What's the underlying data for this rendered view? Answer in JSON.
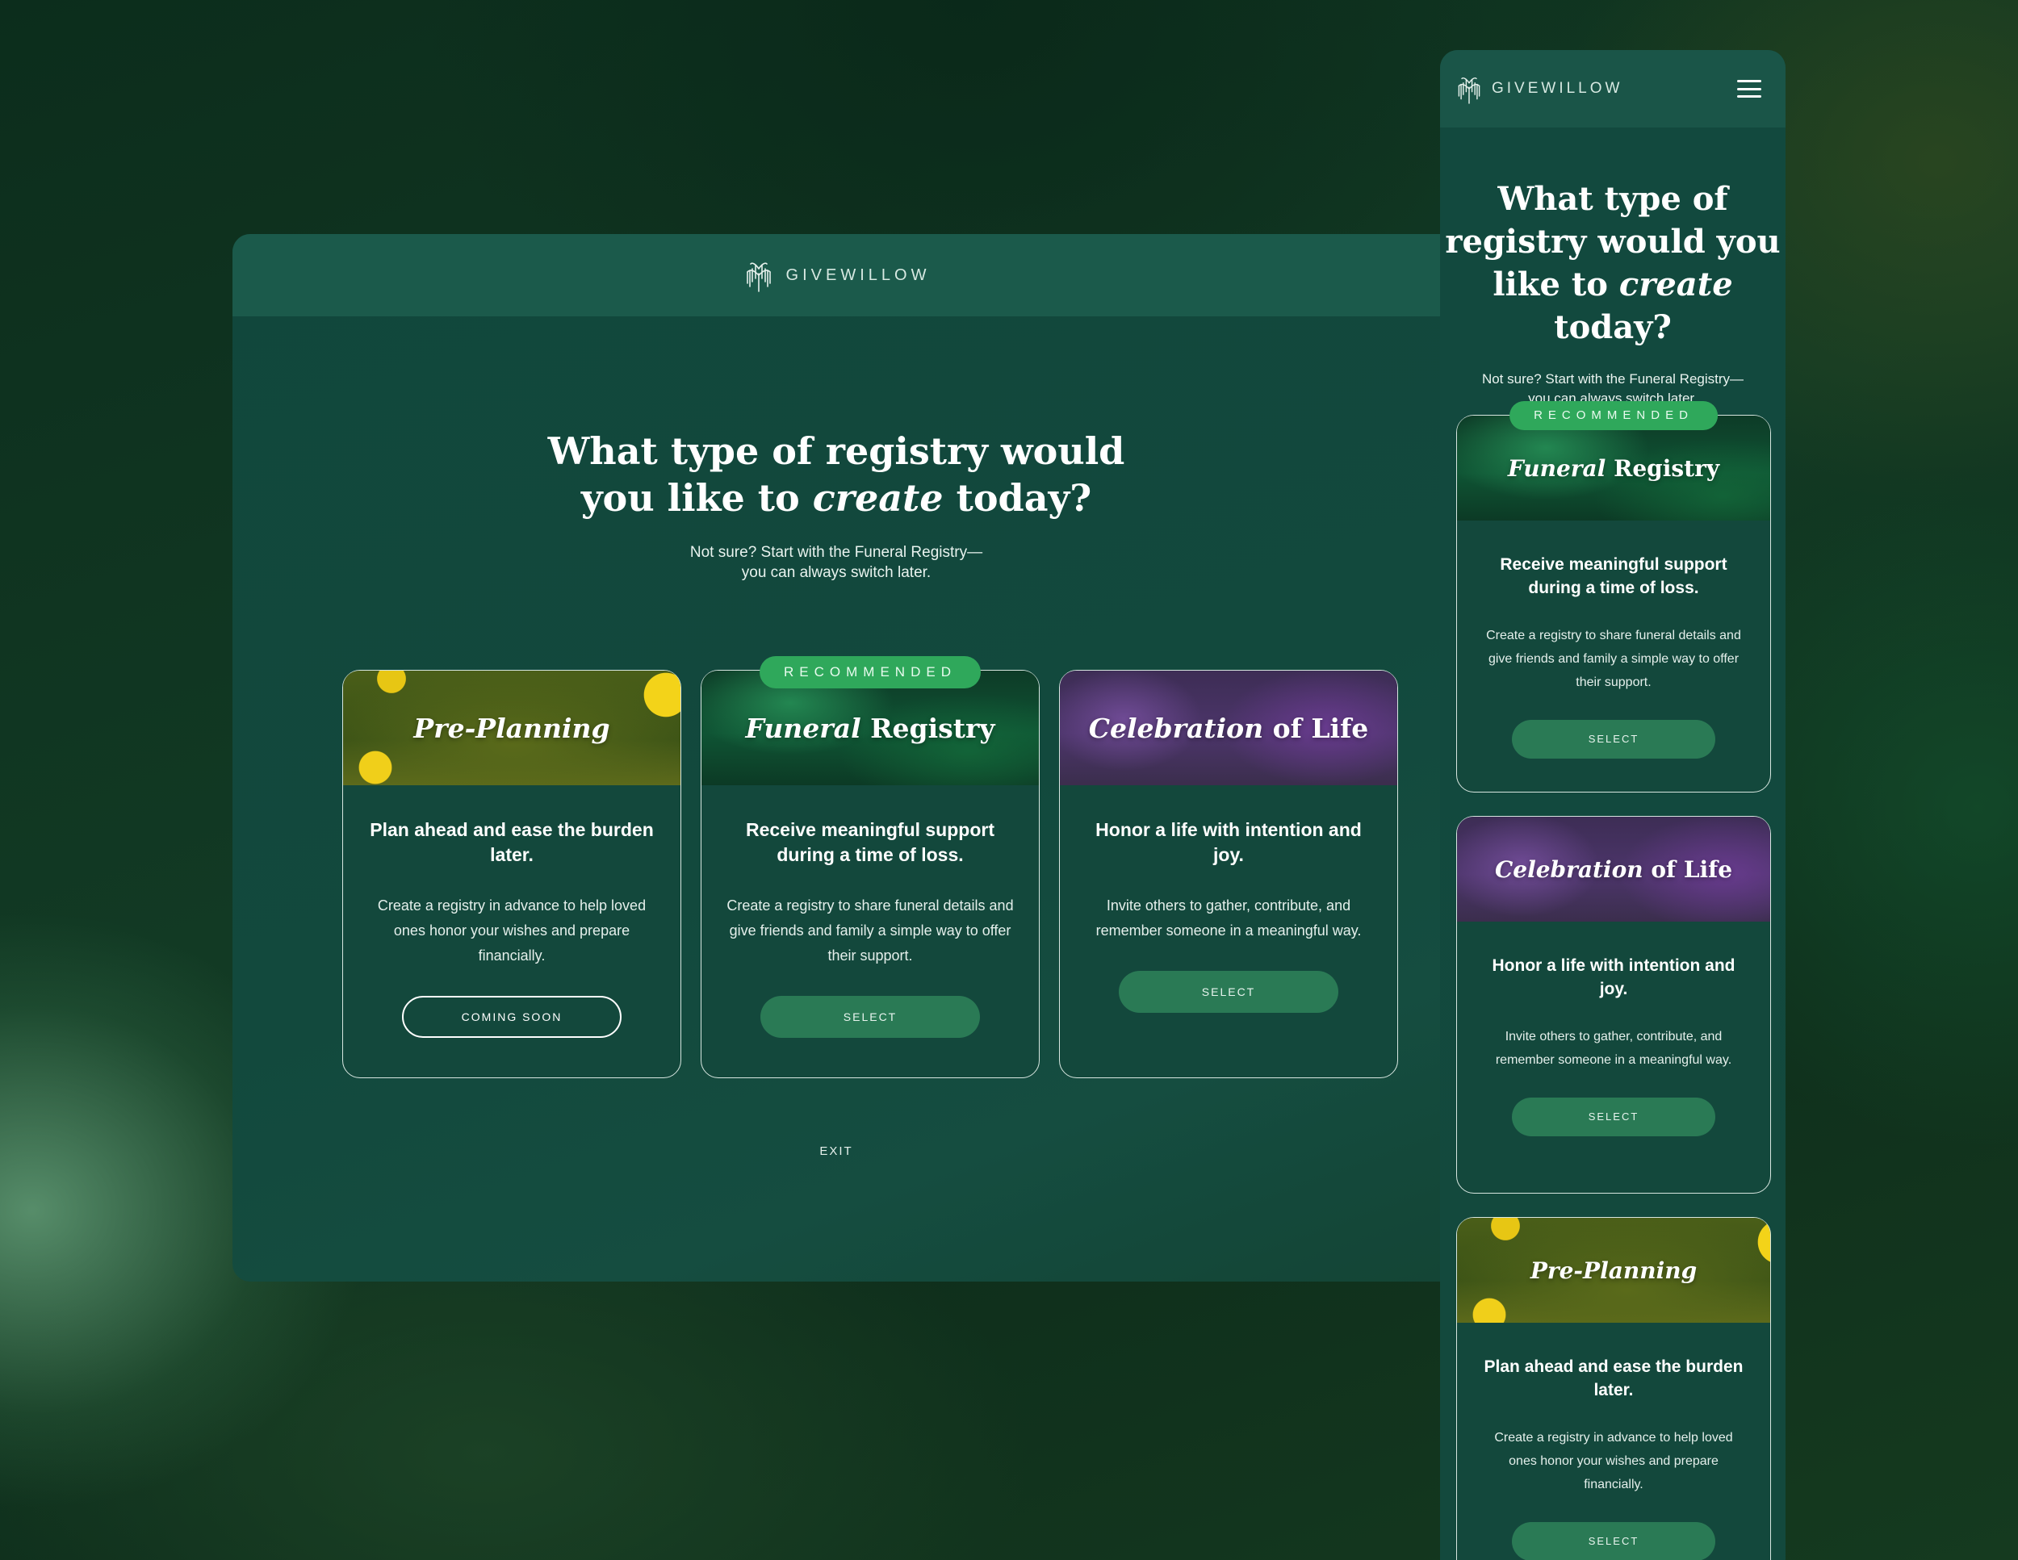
{
  "brand": {
    "name": "GIVEWILLOW"
  },
  "hero": {
    "title_part1": "What type of registry would you like to",
    "title_italic": "create",
    "title_part2": "today?",
    "subtitle_line1": "Not sure? Start with the Funeral Registry—",
    "subtitle_line2": "you can always switch later."
  },
  "badge": {
    "recommended": "RECOMMENDED"
  },
  "cards": {
    "preplanning": {
      "name_italic": "Pre-Planning",
      "heading": "Plan ahead and ease the burden later.",
      "description": "Create a registry in advance to help loved ones honor your wishes and prepare financially.",
      "desktop_button": "COMING SOON",
      "mobile_button": "SELECT"
    },
    "funeral": {
      "name_italic": "Funeral",
      "name_rest": "Registry",
      "heading": "Receive meaningful support during a time of loss.",
      "description": "Create a registry to share funeral details and give friends and family a simple way to offer their support.",
      "button": "SELECT"
    },
    "celebration": {
      "name_italic": "Celebration",
      "name_rest": "of Life",
      "heading": "Honor a life with intention and joy.",
      "description": "Invite others to gather, contribute, and remember someone in a meaningful way.",
      "button": "SELECT"
    }
  },
  "footer": {
    "exit": "EXIT"
  },
  "icons": {
    "logo": "willow-tree-icon",
    "menu": "hamburger-menu-icon"
  },
  "colors": {
    "accent": "#2fa85b",
    "button": "#2a7a55",
    "panel": "#12493d",
    "header": "#1b5a4b"
  }
}
